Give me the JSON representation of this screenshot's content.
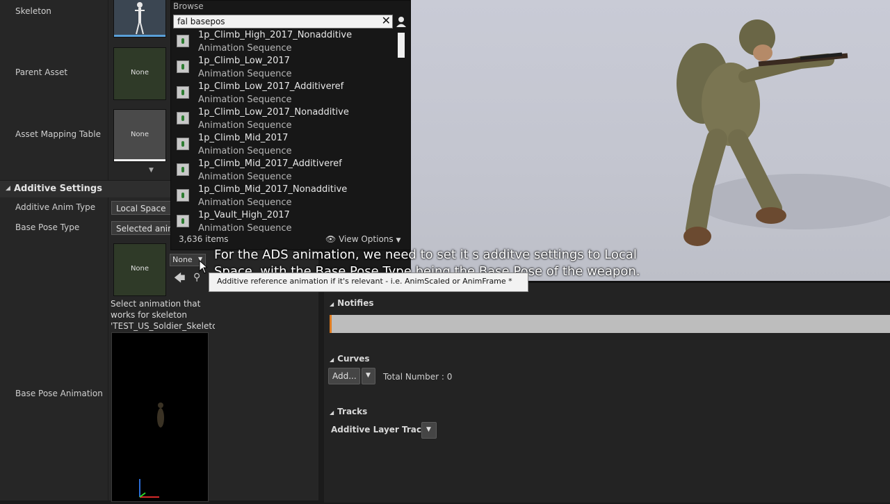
{
  "details": {
    "skeleton_label": "Skeleton",
    "parent_asset_label": "Parent Asset",
    "parent_asset_value": "None",
    "asset_mapping_label": "Asset Mapping Table",
    "asset_mapping_value": "None",
    "additive_section_title": "Additive Settings",
    "additive_anim_type_label": "Additive Anim Type",
    "additive_anim_type_value": "Local Space",
    "base_pose_type_label": "Base Pose Type",
    "base_pose_type_value": "Selected animation",
    "ref_anim_thumb_value": "None",
    "ref_anim_combo_value": "None",
    "select_hint": "Select animation that works for skeleton 'TEST_US_Soldier_Skeleton'",
    "base_pose_animation_label": "Base Pose Animation"
  },
  "browse": {
    "title": "Browse",
    "search_value": "fal basepos",
    "items": [
      {
        "name": "1p_Climb_High_2017_Nonadditive",
        "type": "Animation Sequence"
      },
      {
        "name": "1p_Climb_Low_2017",
        "type": "Animation Sequence"
      },
      {
        "name": "1p_Climb_Low_2017_Additiveref",
        "type": "Animation Sequence"
      },
      {
        "name": "1p_Climb_Low_2017_Nonadditive",
        "type": "Animation Sequence"
      },
      {
        "name": "1p_Climb_Mid_2017",
        "type": "Animation Sequence"
      },
      {
        "name": "1p_Climb_Mid_2017_Additiveref",
        "type": "Animation Sequence"
      },
      {
        "name": "1p_Climb_Mid_2017_Nonadditive",
        "type": "Animation Sequence"
      },
      {
        "name": "1p_Vault_High_2017",
        "type": "Animation Sequence"
      }
    ],
    "item_count": "3,636 items",
    "view_options": "View Options"
  },
  "subtitle": {
    "line1": "For the ADS animation, we need to set it s additve settings to Local",
    "line2": "Space, with the Base Pose Type being the Base Pose of the weapon."
  },
  "tooltip": "Additive reference animation if it's relevant - i.e. AnimScaled or AnimFrame *",
  "timeline": {
    "notifies": "Notifies",
    "curves": "Curves",
    "add_button": "Add...",
    "total_number": "Total Number : 0",
    "tracks": "Tracks",
    "additive_layer_tracks": "Additive Layer Tracks"
  },
  "colors": {
    "panel_bg": "#262626",
    "viewport_bg": "#c9cbd6",
    "thumb_green": "#2f3a28"
  }
}
